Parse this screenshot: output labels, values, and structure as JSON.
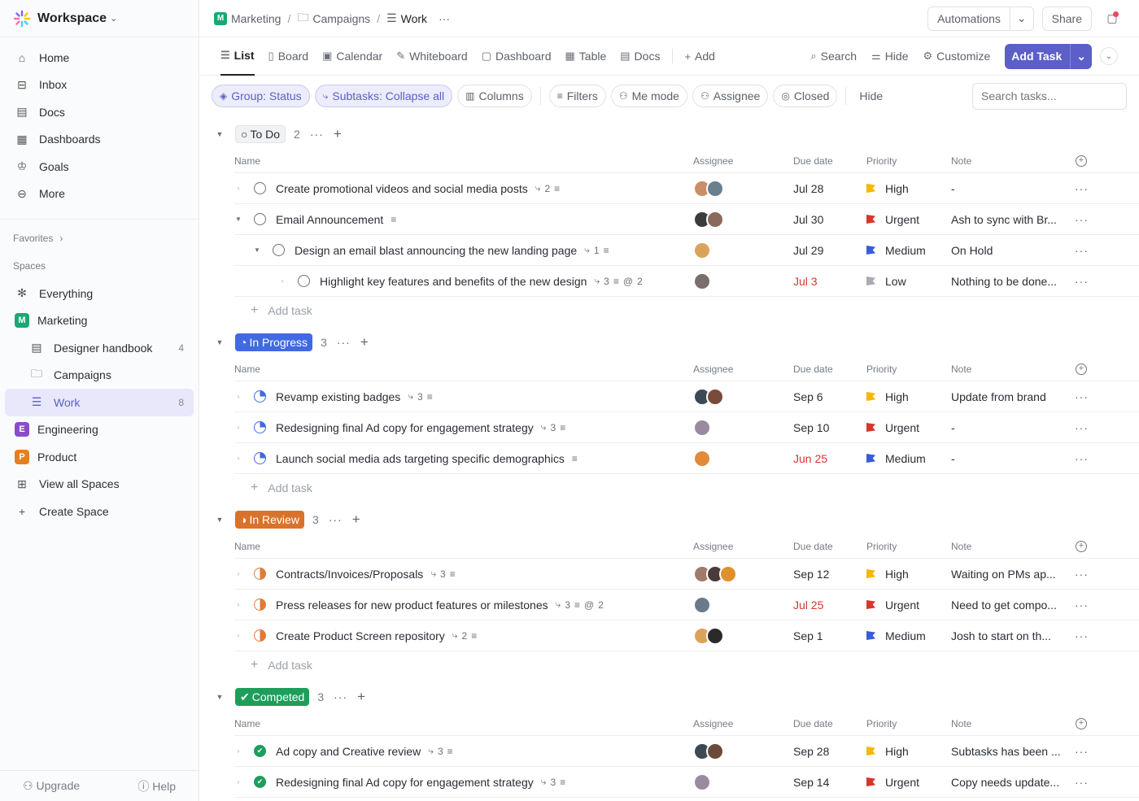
{
  "sidebar": {
    "workspace": "Workspace",
    "nav": [
      {
        "label": "Home",
        "icon": "home-icon"
      },
      {
        "label": "Inbox",
        "icon": "inbox-icon"
      },
      {
        "label": "Docs",
        "icon": "docs-icon"
      },
      {
        "label": "Dashboards",
        "icon": "dashboards-icon"
      },
      {
        "label": "Goals",
        "icon": "goals-icon"
      },
      {
        "label": "More",
        "icon": "more-icon"
      }
    ],
    "favorites": "Favorites",
    "spaces": "Spaces",
    "space_items": [
      {
        "label": "Everything"
      },
      {
        "label": "Marketing",
        "badge": "M",
        "color": "#19a974"
      },
      {
        "label": "Designer handbook",
        "count": "4"
      },
      {
        "label": "Campaigns"
      },
      {
        "label": "Work",
        "count": "8"
      },
      {
        "label": "Engineering",
        "badge": "E",
        "color": "#8b4cc9"
      },
      {
        "label": "Product",
        "badge": "P",
        "color": "#e67e22"
      },
      {
        "label": "View all Spaces"
      },
      {
        "label": "Create Space"
      }
    ],
    "upgrade": "Upgrade",
    "help": "Help"
  },
  "topbar": {
    "crumbs": [
      "Marketing",
      "Campaigns",
      "Work"
    ],
    "automations": "Automations",
    "share": "Share"
  },
  "views": {
    "tabs": [
      "List",
      "Board",
      "Calendar",
      "Whiteboard",
      "Dashboard",
      "Table",
      "Docs"
    ],
    "add": "Add",
    "search": "Search",
    "hide": "Hide",
    "customize": "Customize",
    "add_task": "Add Task"
  },
  "filters": {
    "group": "Group: Status",
    "subtasks": "Subtasks: Collapse all",
    "columns": "Columns",
    "filters": "Filters",
    "me_mode": "Me mode",
    "assignee": "Assignee",
    "closed": "Closed",
    "hide": "Hide",
    "search_placeholder": "Search tasks..."
  },
  "columns": {
    "name": "Name",
    "assignee": "Assignee",
    "due": "Due date",
    "priority": "Priority",
    "note": "Note"
  },
  "add_task_label": "Add task",
  "colors": {
    "accent": "#5b5fc7",
    "high": "#f5b800",
    "urgent": "#d5372c",
    "medium": "#3a5bd9",
    "low": "#a8acb3"
  },
  "groups": [
    {
      "status": "To Do",
      "count": "2",
      "color": "#f1f2f4",
      "tasks": [
        {
          "name": "Create promotional videos and social media posts",
          "meta": "2",
          "due": "Jul 28",
          "priority": "High",
          "note": "-",
          "assignees": [
            "#c98f6a",
            "#6b7f8c"
          ]
        },
        {
          "name": "Email Announcement",
          "meta": "",
          "due": "Jul 30",
          "priority": "Urgent",
          "note": "Ash to sync with Br...",
          "assignees": [
            "#3b3b3b",
            "#8a6a5a"
          ]
        },
        {
          "name": "Design an email blast announcing the new landing page",
          "meta": "1",
          "due": "Jul 29",
          "priority": "Medium",
          "note": "On Hold",
          "assignees": [
            "#d9a45a"
          ]
        },
        {
          "name": "Highlight key features and benefits of the new design",
          "meta": "3",
          "meta2": "2",
          "due": "Jul 3",
          "due_red": true,
          "priority": "Low",
          "note": "Nothing to be done...",
          "assignees": [
            "#7a6e6e"
          ]
        }
      ]
    },
    {
      "status": "In Progress",
      "count": "3",
      "color": "#4169e1",
      "tasks": [
        {
          "name": "Revamp existing badges",
          "meta": "3",
          "due": "Sep 6",
          "priority": "High",
          "note": "Update from brand",
          "assignees": [
            "#3b4a55",
            "#7a4a3a"
          ]
        },
        {
          "name": "Redesigning final Ad copy for engagement strategy",
          "meta": "3",
          "due": "Sep 10",
          "priority": "Urgent",
          "note": "-",
          "assignees": [
            "#9a8aa0"
          ]
        },
        {
          "name": "Launch social media ads targeting specific demographics",
          "meta": "",
          "due": "Jun 25",
          "due_red": true,
          "priority": "Medium",
          "note": "-",
          "assignees": [
            "#e08a3a"
          ]
        }
      ]
    },
    {
      "status": "In Review",
      "count": "3",
      "color": "#d9722b",
      "tasks": [
        {
          "name": "Contracts/Invoices/Proposals",
          "meta": "3",
          "due": "Sep 12",
          "priority": "High",
          "note": "Waiting on PMs ap...",
          "assignees": [
            "#a07a6a",
            "#4a3a3a",
            "#e0902a"
          ]
        },
        {
          "name": "Press releases for new product features or milestones",
          "meta": "3",
          "meta2": "2",
          "due": "Jul 25",
          "due_red": true,
          "priority": "Urgent",
          "note": "Need to get compo...",
          "assignees": [
            "#6a7a8a"
          ]
        },
        {
          "name": "Create Product Screen repository",
          "meta": "2",
          "due": "Sep 1",
          "priority": "Medium",
          "note": "Josh to start on th...",
          "assignees": [
            "#d9a45a",
            "#2a2a2a"
          ]
        }
      ]
    },
    {
      "status": "Competed",
      "count": "3",
      "color": "#1e9e5a",
      "tasks": [
        {
          "name": "Ad copy and Creative review",
          "meta": "3",
          "due": "Sep 28",
          "priority": "High",
          "note": "Subtasks has been ...",
          "assignees": [
            "#3b4a55",
            "#6a4a3a"
          ]
        },
        {
          "name": "Redesigning final Ad copy for engagement strategy",
          "meta": "3",
          "due": "Sep 14",
          "priority": "Urgent",
          "note": "Copy needs update...",
          "assignees": [
            "#9a8aa0"
          ]
        }
      ]
    }
  ]
}
